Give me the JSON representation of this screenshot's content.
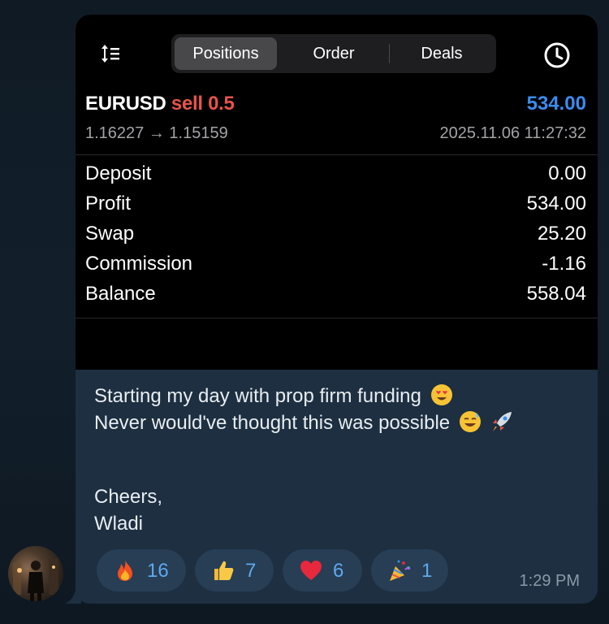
{
  "screenshot": {
    "tabs": [
      {
        "label": "Positions",
        "active": true
      },
      {
        "label": "Order",
        "active": false
      },
      {
        "label": "Deals",
        "active": false
      }
    ],
    "deal": {
      "symbol": "EURUSD",
      "type": "sell 0.5",
      "amount": "534.00",
      "prices": "1.16227 → 1.15159",
      "datetime": "2025.11.06 11:27:32"
    },
    "summary": [
      {
        "label": "Deposit",
        "value": "0.00"
      },
      {
        "label": "Profit",
        "value": "534.00"
      },
      {
        "label": "Swap",
        "value": "25.20"
      },
      {
        "label": "Commission",
        "value": "-1.16"
      },
      {
        "label": "Balance",
        "value": "558.04"
      }
    ]
  },
  "message": {
    "line1": "Starting my day with prop firm funding",
    "line2": "Never would've thought this was possible",
    "line3": "Cheers,",
    "line4": "Wladi",
    "time": "1:29 PM"
  },
  "reactions": [
    {
      "icon": "fire-icon",
      "count": "16"
    },
    {
      "icon": "thumbs-up-icon",
      "count": "7"
    },
    {
      "icon": "heart-icon",
      "count": "6"
    },
    {
      "icon": "party-popper-icon",
      "count": "1"
    }
  ],
  "colors": {
    "sell": "#e8544a",
    "amount": "#3b8cf0",
    "bubble": "#1d2f40",
    "reaction_bg": "#273e55",
    "reaction_text": "#5fa9ee"
  }
}
